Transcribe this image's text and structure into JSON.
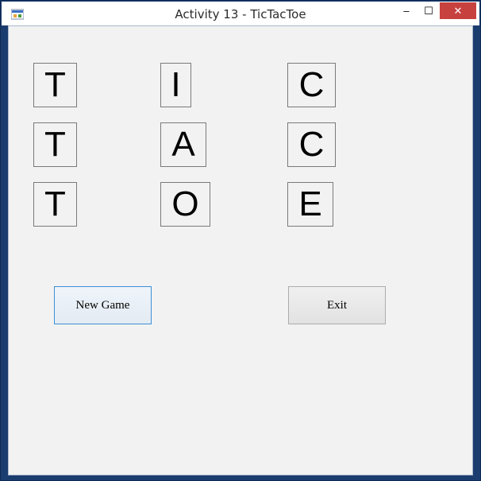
{
  "window": {
    "title": "Activity 13 - TicTacToe",
    "controls": {
      "minimize": "–",
      "maximize": "☐",
      "close": "✕"
    }
  },
  "board": {
    "rows": [
      [
        "T",
        "I",
        "C"
      ],
      [
        "T",
        "A",
        "C"
      ],
      [
        "T",
        "O",
        "E"
      ]
    ]
  },
  "buttons": {
    "new_game": "New Game",
    "exit": "Exit"
  },
  "colors": {
    "frame": "#1b3c6e",
    "close_button": "#c7413f",
    "client_background": "#f2f2f2"
  }
}
